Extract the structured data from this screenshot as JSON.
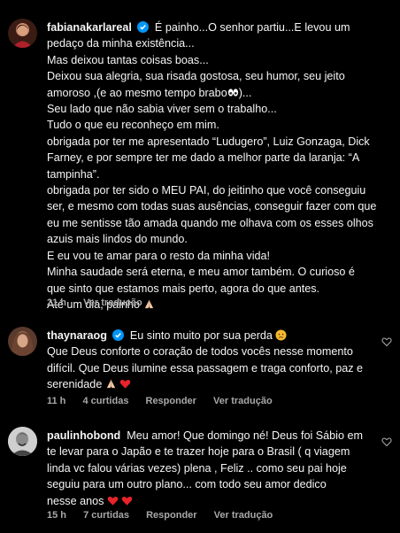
{
  "comments": [
    {
      "username": "fabianakarlareal",
      "verified": true,
      "lines": [
        "É painho...O senhor partiu...E levou um",
        "pedaço da minha existência...",
        "Mas deixou tantas coisas boas...",
        "Deixou sua alegria, sua risada gostosa, seu humor, seu jeito",
        "amoroso ,(e ao mesmo tempo brabo",
        "Seu lado que não sabia viver sem o trabalho...",
        "Tudo o que eu reconheço em mim.",
        "obrigada por ter me apresentado “Ludugero”, Luiz Gonzaga, Dick",
        "Farney, e por sempre ter me dado a melhor parte da laranja: “A",
        "tampinha”.",
        "obrigada por ter sido o MEU PAI, do jeitinho que você conseguiu",
        "ser, e mesmo com todas suas ausências, conseguir fazer com que",
        "eu me sentisse tão amada quando me olhava com os esses olhos",
        "azuis mais lindos do mundo.",
        "E eu vou te amar para o resto da minha vida!",
        "Minha saudade será eterna, e meu amor também. O curioso é",
        "que sinto que estamos mais perto, agora do que antes.",
        "Até um dia, painho"
      ],
      "line5_suffix": ")...",
      "time": "21 h",
      "likes": "",
      "reply": "",
      "translate": "Ver tradução"
    },
    {
      "username": "thaynaraog",
      "verified": true,
      "lines": [
        "Eu sinto muito por sua perda",
        "Que Deus conforte o coração de todos vocês nesse momento",
        "difícil. Que Deus ilumine essa passagem e traga conforto, paz e",
        "serenidade"
      ],
      "time": "11 h",
      "likes": "4 curtidas",
      "reply": "Responder",
      "translate": "Ver tradução"
    },
    {
      "username": "paulinhobond",
      "verified": false,
      "lines": [
        "Meu amor! Que domingo né! Deus foi Sábio em",
        "te levar para o Japão e te trazer hoje para o Brasil ( q viagem",
        "linda vc falou várias vezes) plena , Feliz .. como seu pai hoje",
        "seguiu para um outro plano... com todo seu amor dedico",
        "nesse anos"
      ],
      "time": "15 h",
      "likes": "7 curtidas",
      "reply": "Responder",
      "translate": "Ver tradução"
    }
  ],
  "colors": {
    "background": "#000000",
    "text": "#f5f5f5",
    "meta": "#a8a8a8",
    "verified": "#0095f6",
    "heart_emoji": "#e8232b"
  },
  "icons": {
    "verified": "verified-badge-icon",
    "like": "heart-outline-icon"
  }
}
